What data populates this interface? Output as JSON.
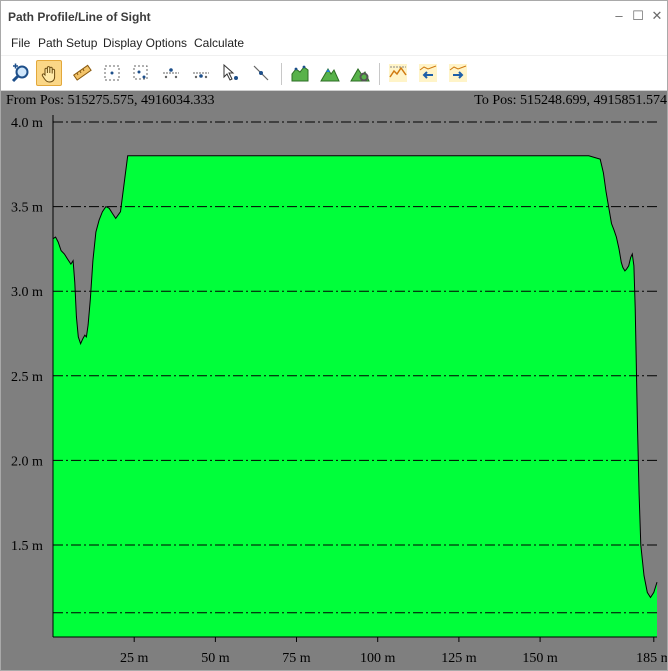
{
  "window": {
    "title": "Path Profile/Line of Sight",
    "minimize_glyph": "–",
    "maximize_glyph": "☐",
    "close_glyph": "✕"
  },
  "menu": [
    {
      "label": "File"
    },
    {
      "label": "Path Setup"
    },
    {
      "label": "Display Options"
    },
    {
      "label": "Calculate"
    }
  ],
  "toolbar": {
    "icons": [
      "zoom-icon",
      "pan-hand-icon",
      "measure-ruler-icon",
      "select-box-icon",
      "select-points-icon",
      "insert-point-icon",
      "delete-point-icon",
      "pointer-move-icon",
      "pointer-edit-icon",
      "profile-chart-icon",
      "terrain-peaks-icon",
      "terrain-edit-icon",
      "line-of-sight-icon",
      "previous-profile-icon",
      "next-profile-icon"
    ],
    "active": "pan-hand-icon"
  },
  "header": {
    "from_label": "From Pos: 515275.575, 4916034.333",
    "to_label": "To Pos: 515248.699, 4915851.574"
  },
  "colors": {
    "fill": "#00ff3a",
    "background": "#7f7f7f",
    "outline": "#000000",
    "grid": "#000000"
  },
  "chart_data": {
    "type": "area",
    "title": "",
    "xlabel": "",
    "ylabel": "",
    "xlim": [
      0,
      186
    ],
    "ylim": [
      1.0,
      4.0
    ],
    "x_ticks": [
      {
        "value": 25,
        "label": "25 m"
      },
      {
        "value": 50,
        "label": "50 m"
      },
      {
        "value": 75,
        "label": "75 m"
      },
      {
        "value": 100,
        "label": "100 m"
      },
      {
        "value": 125,
        "label": "125 m"
      },
      {
        "value": 150,
        "label": "150 m"
      },
      {
        "value": 185,
        "label": "185 m"
      }
    ],
    "y_ticks": [
      {
        "value": 1.5,
        "label": "1.5 m"
      },
      {
        "value": 2.0,
        "label": "2.0 m"
      },
      {
        "value": 2.5,
        "label": "2.5 m"
      },
      {
        "value": 3.0,
        "label": "3.0 m"
      },
      {
        "value": 3.5,
        "label": "3.5 m"
      },
      {
        "value": 4.0,
        "label": "4.0 m"
      }
    ],
    "gridlines_y": [
      1.1,
      1.5,
      2.0,
      2.5,
      3.0,
      3.5,
      4.0
    ],
    "grid": "dash-dot horizontal",
    "series": [
      {
        "x": [
          0,
          0.8,
          1.6,
          2.5,
          3.5,
          4.5,
          5.5,
          6.2,
          6.7,
          7.2,
          7.8,
          8.5,
          9.2,
          9.8,
          10.3,
          10.8,
          11.5,
          12.3,
          13.2,
          14.2,
          15.2,
          16.3,
          17.3,
          18.3,
          19.3,
          20.8,
          23.0,
          30,
          60,
          100,
          140,
          165,
          168.5,
          169.5,
          170.3,
          171.0,
          172.0,
          172.8,
          173.5,
          174.3,
          175.0,
          175.5,
          176.1,
          176.6,
          177.3,
          177.9,
          178.4,
          178.9,
          179.3,
          179.6,
          180.0,
          180.5,
          181.0,
          182.0,
          183.0,
          184.0,
          185.0,
          186.0
        ],
        "y": [
          3.31,
          3.32,
          3.29,
          3.24,
          3.22,
          3.19,
          3.16,
          3.18,
          3.05,
          2.85,
          2.73,
          2.69,
          2.72,
          2.74,
          2.73,
          2.8,
          2.95,
          3.18,
          3.35,
          3.42,
          3.47,
          3.5,
          3.49,
          3.46,
          3.43,
          3.47,
          3.8,
          3.8,
          3.8,
          3.8,
          3.8,
          3.8,
          3.78,
          3.7,
          3.59,
          3.51,
          3.4,
          3.36,
          3.32,
          3.25,
          3.17,
          3.14,
          3.12,
          3.13,
          3.15,
          3.2,
          3.22,
          3.15,
          2.9,
          2.6,
          2.2,
          1.8,
          1.5,
          1.32,
          1.22,
          1.19,
          1.22,
          1.28
        ]
      }
    ]
  }
}
